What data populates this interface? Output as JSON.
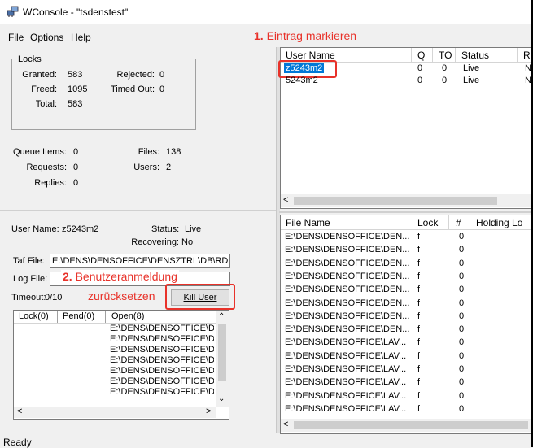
{
  "window": {
    "title": "WConsole - \"tsdenstest\""
  },
  "menu": {
    "file": "File",
    "options": "Options",
    "help": "Help"
  },
  "annotations": {
    "step1_num": "1.",
    "step1_text": "Eintrag markieren",
    "step2_num": "2.",
    "step2_text_a": "Benutzeranmeldung",
    "step2_text_b": "zurücksetzen"
  },
  "locks": {
    "group_label": "Locks",
    "granted_label": "Granted:",
    "granted_value": "583",
    "rejected_label": "Rejected:",
    "rejected_value": "0",
    "freed_label": "Freed:",
    "freed_value": "1095",
    "timedout_label": "Timed Out:",
    "timedout_value": "0",
    "total_label": "Total:",
    "total_value": "583"
  },
  "stats": {
    "queue_label": "Queue Items:",
    "queue_value": "0",
    "files_label": "Files:",
    "files_value": "138",
    "requests_label": "Requests:",
    "requests_value": "0",
    "users_label": "Users:",
    "users_value": "2",
    "replies_label": "Replies:",
    "replies_value": "0"
  },
  "users_table": {
    "columns": [
      "User Name",
      "Q",
      "TO",
      "Status",
      "R"
    ],
    "rows": [
      {
        "name": "z5243m2",
        "q": "0",
        "to": "0",
        "status": "Live",
        "r": "N"
      },
      {
        "name": "5243m2",
        "q": "0",
        "to": "0",
        "status": "Live",
        "r": "N"
      }
    ]
  },
  "user_detail": {
    "user_name_label": "User Name:",
    "user_name_value": "z5243m2",
    "status_label": "Status:",
    "status_value": "Live",
    "recovering_label": "Recovering:",
    "recovering_value": "No",
    "taf_label": "Taf File:",
    "taf_value": "E:\\DENS\\DENSOFFICE\\DENSZTRL\\DB\\RD",
    "log_label": "Log File:",
    "log_value": "",
    "timeout_label": "Timeout:",
    "timeout_value": "0/10",
    "kill_button": "Kill User"
  },
  "lock_list": {
    "columns": [
      "Lock(0)",
      "Pend(0)",
      "Open(8)"
    ],
    "rows": [
      "E:\\DENS\\DENSOFFICE\\D",
      "E:\\DENS\\DENSOFFICE\\D",
      "E:\\DENS\\DENSOFFICE\\D",
      "E:\\DENS\\DENSOFFICE\\D",
      "E:\\DENS\\DENSOFFICE\\D",
      "E:\\DENS\\DENSOFFICE\\D",
      "E:\\DENS\\DENSOFFICE\\D"
    ]
  },
  "files_table": {
    "columns": [
      "File Name",
      "Lock",
      "#",
      "Holding Lo"
    ],
    "rows": [
      {
        "name": "E:\\DENS\\DENSOFFICE\\DEN...",
        "lock": "f",
        "n": "0"
      },
      {
        "name": "E:\\DENS\\DENSOFFICE\\DEN...",
        "lock": "f",
        "n": "0"
      },
      {
        "name": "E:\\DENS\\DENSOFFICE\\DEN...",
        "lock": "f",
        "n": "0"
      },
      {
        "name": "E:\\DENS\\DENSOFFICE\\DEN...",
        "lock": "f",
        "n": "0"
      },
      {
        "name": "E:\\DENS\\DENSOFFICE\\DEN...",
        "lock": "f",
        "n": "0"
      },
      {
        "name": "E:\\DENS\\DENSOFFICE\\DEN...",
        "lock": "f",
        "n": "0"
      },
      {
        "name": "E:\\DENS\\DENSOFFICE\\DEN...",
        "lock": "f",
        "n": "0"
      },
      {
        "name": "E:\\DENS\\DENSOFFICE\\DEN...",
        "lock": "f",
        "n": "0"
      },
      {
        "name": "E:\\DENS\\DENSOFFICE\\LAV...",
        "lock": "f",
        "n": "0"
      },
      {
        "name": "E:\\DENS\\DENSOFFICE\\LAV...",
        "lock": "f",
        "n": "0"
      },
      {
        "name": "E:\\DENS\\DENSOFFICE\\LAV...",
        "lock": "f",
        "n": "0"
      },
      {
        "name": "E:\\DENS\\DENSOFFICE\\LAV...",
        "lock": "f",
        "n": "0"
      },
      {
        "name": "E:\\DENS\\DENSOFFICE\\LAV...",
        "lock": "f",
        "n": "0"
      },
      {
        "name": "E:\\DENS\\DENSOFFICE\\LAV...",
        "lock": "f",
        "n": "0"
      }
    ]
  },
  "status_bar": {
    "text": "Ready"
  },
  "colors": {
    "annotation": "#e8322a",
    "selection": "#0078d7"
  }
}
